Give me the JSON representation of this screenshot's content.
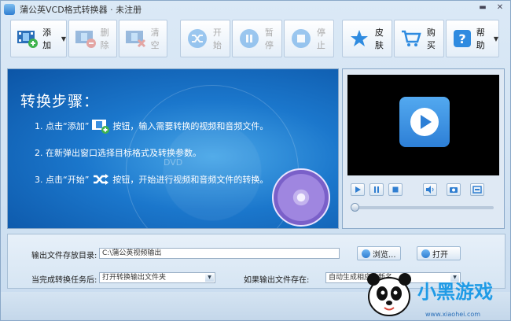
{
  "window": {
    "title": "蒲公英VCD格式转换器 · 未注册",
    "controls": [
      "minimize-icon",
      "close-icon"
    ]
  },
  "toolbar": {
    "add": {
      "label": "添加",
      "has_dropdown": true,
      "icon": "film-add-icon",
      "enabled": true
    },
    "remove": {
      "label": "删除",
      "icon": "film-remove-icon",
      "enabled": false
    },
    "clear": {
      "label": "清空",
      "icon": "film-clear-icon",
      "enabled": false
    },
    "start": {
      "label": "开始",
      "icon": "shuffle-icon",
      "enabled": false
    },
    "pause": {
      "label": "暂停",
      "icon": "pause-icon",
      "enabled": false
    },
    "stop": {
      "label": "停止",
      "icon": "stop-icon",
      "enabled": false
    },
    "skin": {
      "label": "皮肤",
      "icon": "star-icon",
      "enabled": true
    },
    "buy": {
      "label": "购买",
      "icon": "cart-icon",
      "enabled": true
    },
    "help": {
      "label": "帮助",
      "has_dropdown": true,
      "icon": "help-icon",
      "enabled": true
    }
  },
  "steps": {
    "title": "转换步骤：",
    "step1_a": "1. 点击“添加”",
    "step1_b": "按钮，输入需要转换的视频和音频文件。",
    "step2": "2. 在新弹出窗口选择目标格式及转换参数。",
    "step3_a": "3. 点击“开始”",
    "step3_b": "按钮，开始进行视频和音频文件的转换。",
    "background_mark": "DVD"
  },
  "player": {
    "controls": [
      "play-icon",
      "pause-icon",
      "stop-icon",
      "volume-icon",
      "snapshot-icon",
      "fullscreen-icon"
    ],
    "progress": 0.0
  },
  "settings": {
    "output_dir_label": "输出文件存放目录:",
    "output_dir_value": "C:\\蒲公英视频输出",
    "browse_label": "浏览...",
    "open_label": "打开",
    "after_done_label": "当完成转换任务后:",
    "after_done_value": "打开转换输出文件夹",
    "if_exists_label": "如果输出文件存在:",
    "if_exists_value": "自动生成相应的新名"
  },
  "watermark": {
    "text": "小黑游戏",
    "url": "www.xiaohei.com"
  },
  "colors": {
    "accent": "#2f7ed1",
    "banner_dark": "#0c55a6",
    "banner_light": "#49a7e8",
    "disc": "#9f86e0",
    "star": "#2f8be0",
    "cart": "#2f8be0",
    "remove_badge": "#d9483b"
  }
}
